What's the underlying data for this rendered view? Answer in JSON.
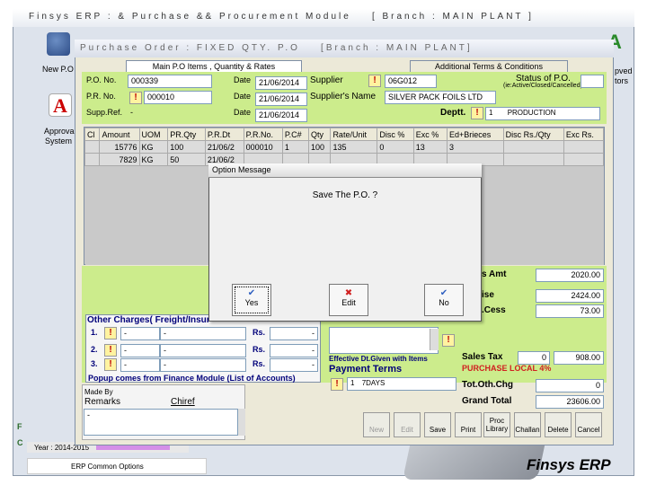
{
  "outer_window": {
    "title": "Finsys ERP : & Purchase && Procurement Module",
    "branch": "[ Branch : MAIN PLANT ]"
  },
  "desktop": {
    "label_new_po": "New P.O",
    "label_approval": "Approval",
    "label_system": "System",
    "label_right_1": "pved",
    "label_right_2": "tors",
    "year_label": "Year : 2014-2015",
    "common_options": "ERP Common Options",
    "brand": "Finsys ERP",
    "left_letters": [
      "F",
      "C"
    ]
  },
  "po_window": {
    "title": "Purchase Order : FIXED QTY. P.O",
    "branch": "[Branch : MAIN PLANT]"
  },
  "tabs": [
    "Main P.O Items , Quantity & Rates",
    "Additional Terms & Conditions"
  ],
  "header": {
    "po_no_label": "P.O. No.",
    "po_no": "000339",
    "pr_no_label": "P.R. No.",
    "pr_no": "000010",
    "supp_ref_label": "Supp.Ref.",
    "supp_ref": "-",
    "date_label": "Date",
    "po_date": "21/06/2014",
    "pr_date": "21/06/2014",
    "ref_date": "21/06/2014",
    "supplier_label": "Supplier",
    "supplier_code": "06G012",
    "supplier_name_label": "Supplier's Name",
    "supplier_name": "SILVER PACK FOILS LTD",
    "status_label": "Status of P.O.",
    "status_hint": "(ie:Active/Closed/Cancelled)",
    "deptt_label": "Deptt.",
    "deptt_code": "1",
    "deptt_name": "PRODUCTION"
  },
  "grid": {
    "columns": [
      "Cl",
      "Amount",
      "UOM",
      "PR.Qty",
      "P.R.Dt",
      "P.R.No.",
      "P.C#",
      "Qty",
      "Rate/Unit",
      "Disc %",
      "Exc %",
      "Ed+Brieces",
      "Disc Rs./Qty",
      "Exc Rs."
    ],
    "rows": [
      [
        "",
        "15776",
        "KG",
        "100",
        "21/06/2",
        "000010",
        "1",
        "100",
        "135",
        "0",
        "13",
        "3",
        "",
        ""
      ],
      [
        "",
        "7829",
        "KG",
        "50",
        "21/06/2",
        "",
        "",
        "",
        "",
        "",
        "",
        "",
        "",
        ""
      ]
    ]
  },
  "totals": {
    "amt_label": "s Amt",
    "amt": "2020.00",
    "tax_label": "ise",
    "tax": "2424.00",
    "cess_label": ".Cess",
    "cess": "73.00",
    "sales_tax_label": "Sales Tax",
    "sales_tax_pct": "0",
    "sales_tax": "908.00",
    "purchase_type": "PURCHASE LOCAL 4%",
    "tot_oth_label": "Tot.Oth.Chg",
    "tot_oth": "0",
    "grand_total_label": "Grand Total",
    "grand_total": "23606.00"
  },
  "other_charges": {
    "title": "Other Charges( Freight/Insur",
    "rows": [
      {
        "num": "1.",
        "code": "-",
        "desc": "-",
        "rs_label": "Rs.",
        "amt": "-"
      },
      {
        "num": "2.",
        "code": "-",
        "desc": "-",
        "rs_label": "Rs.",
        "amt": "-"
      },
      {
        "num": "3.",
        "code": "-",
        "desc": "-",
        "rs_label": "Rs.",
        "amt": "-"
      }
    ],
    "popup_note": "Popup comes from Finance Module (List of Accounts)"
  },
  "effective_label": "Effective Dt.Given with Items",
  "payment": {
    "label": "Payment Terms",
    "code": "1",
    "value": "7DAYS"
  },
  "made_by": {
    "label": "Made By",
    "name": "Chiref"
  },
  "remarks": {
    "label": "Remarks",
    "value": "-"
  },
  "toolbar": [
    "New",
    "Edit",
    "Save",
    "Print",
    "Proc Library",
    "Challan",
    "Delete",
    "Cancel"
  ],
  "dialog": {
    "title": "Option Message",
    "message": "Save The P.O. ?",
    "buttons": [
      "Yes",
      "Edit",
      "No"
    ]
  }
}
